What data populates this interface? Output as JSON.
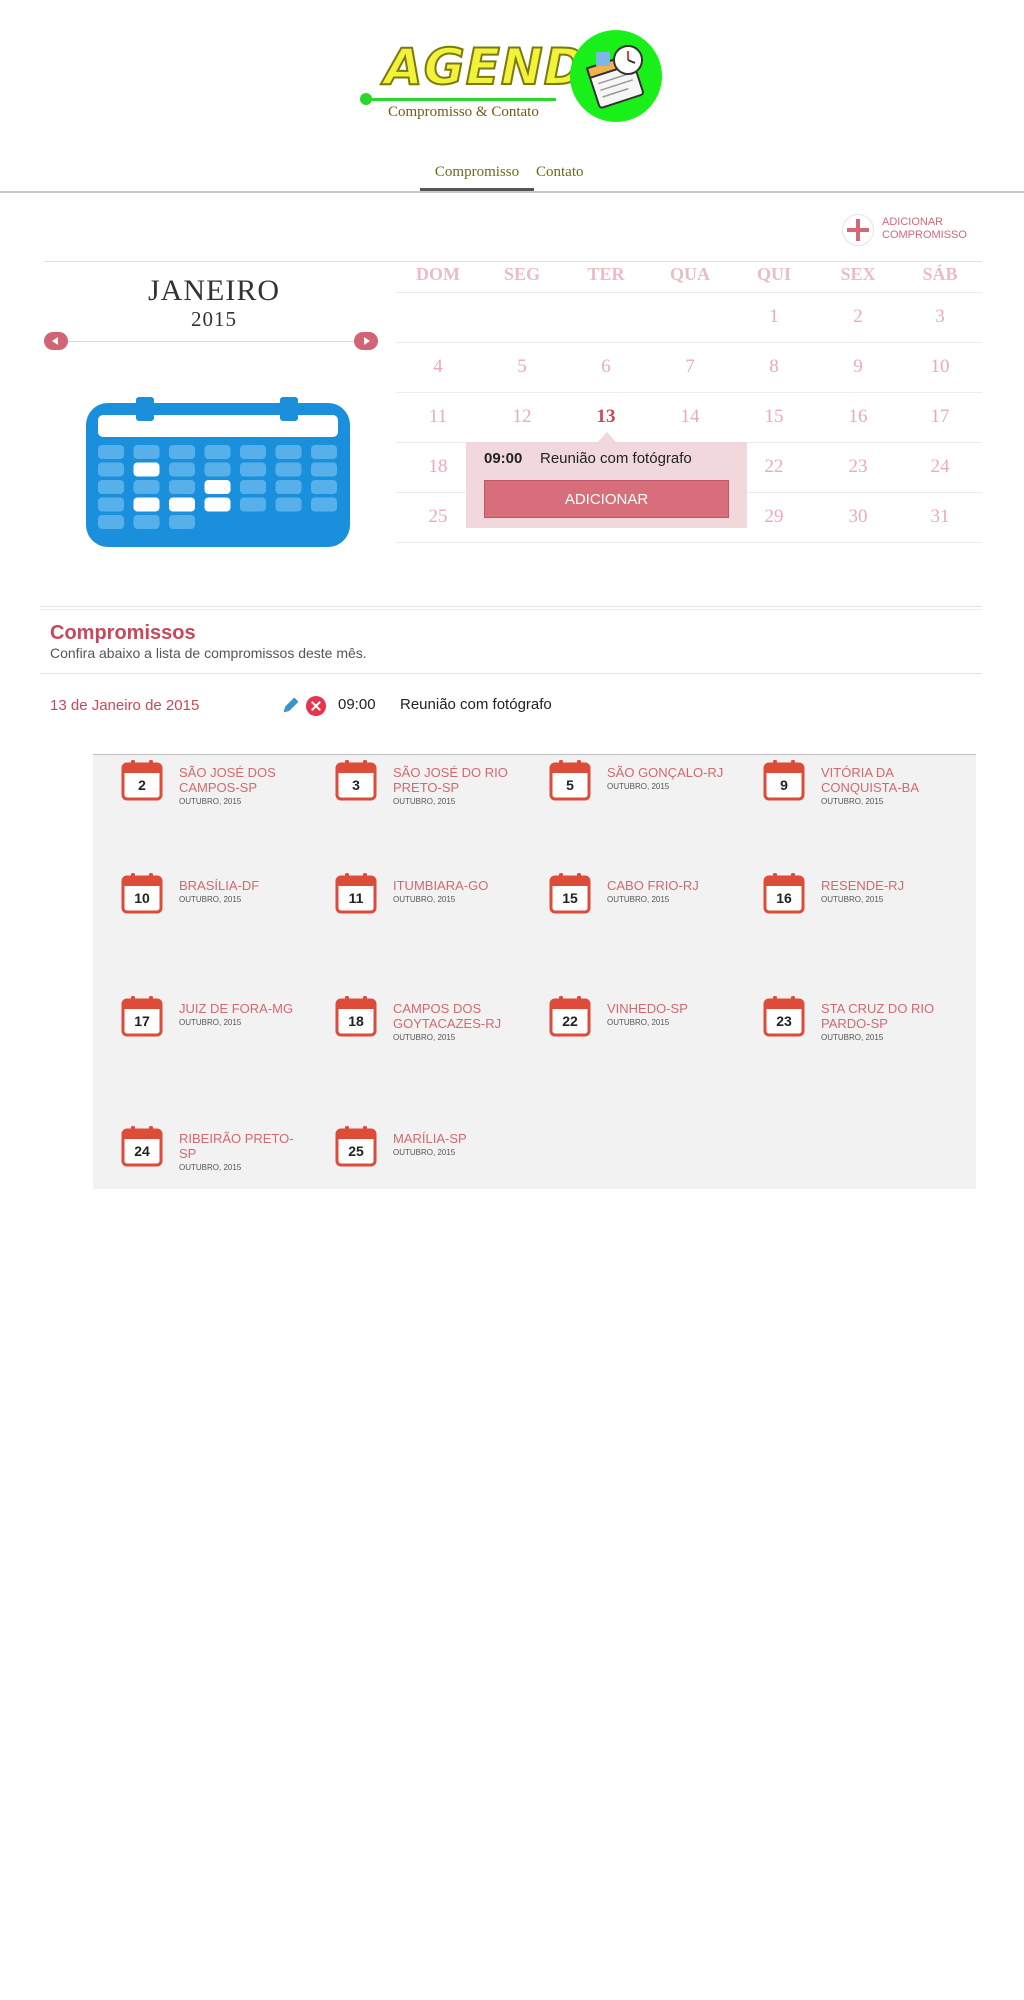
{
  "logo": {
    "word": "AGENDA",
    "subtitle": "Compromisso & Contato"
  },
  "nav": {
    "tabs": [
      {
        "label": "Compromisso"
      },
      {
        "label": "Contato"
      }
    ]
  },
  "actions": {
    "add_appointment_line1": "ADICIONAR",
    "add_appointment_line2": "COMPROMISSO"
  },
  "month": {
    "name": "JANEIRO",
    "year": "2015"
  },
  "calendar": {
    "weekdays": [
      "DOM",
      "SEG",
      "TER",
      "QUA",
      "QUI",
      "SEX",
      "SÁB"
    ],
    "today": 13,
    "days": [
      [
        "",
        "",
        "",
        "",
        "1",
        "2",
        "3"
      ],
      [
        "4",
        "5",
        "6",
        "7",
        "8",
        "9",
        "10"
      ],
      [
        "11",
        "12",
        "13",
        "14",
        "15",
        "16",
        "17"
      ],
      [
        "18",
        "",
        "",
        "",
        "22",
        "23",
        "24"
      ],
      [
        "25",
        "",
        "",
        "",
        "29",
        "30",
        "31"
      ]
    ]
  },
  "popup": {
    "time": "09:00",
    "title": "Reunião com fotógrafo",
    "button": "ADICIONAR"
  },
  "compromissos": {
    "title": "Compromissos",
    "subtitle": "Confira abaixo a lista de compromissos deste mês.",
    "items": [
      {
        "date": "13 de Janeiro de 2015",
        "time": "09:00",
        "title": "Reunião com fotógrafo"
      }
    ]
  },
  "events": [
    {
      "day": "2",
      "city": "SÃO JOSÉ DOS CAMPOS-SP",
      "month": "OUTUBRO, 2015"
    },
    {
      "day": "3",
      "city": "SÃO JOSÉ DO RIO PRETO-SP",
      "month": "OUTUBRO, 2015"
    },
    {
      "day": "5",
      "city": "SÃO GONÇALO-RJ",
      "month": "OUTUBRO, 2015"
    },
    {
      "day": "9",
      "city": "VITÓRIA DA CONQUISTA-BA",
      "month": "OUTUBRO, 2015"
    },
    {
      "day": "10",
      "city": "BRASÍLIA-DF",
      "month": "OUTUBRO, 2015"
    },
    {
      "day": "11",
      "city": "ITUMBIARA-GO",
      "month": "OUTUBRO, 2015"
    },
    {
      "day": "15",
      "city": "CABO FRIO-RJ",
      "month": "OUTUBRO, 2015"
    },
    {
      "day": "16",
      "city": "RESENDE-RJ",
      "month": "OUTUBRO, 2015"
    },
    {
      "day": "17",
      "city": "JUIZ DE FORA-MG",
      "month": "OUTUBRO, 2015"
    },
    {
      "day": "18",
      "city": "CAMPOS DOS GOYTACAZES-RJ",
      "month": "OUTUBRO, 2015"
    },
    {
      "day": "22",
      "city": "VINHEDO-SP",
      "month": "OUTUBRO, 2015"
    },
    {
      "day": "23",
      "city": "STA CRUZ DO RIO PARDO-SP",
      "month": "OUTUBRO, 2015"
    },
    {
      "day": "24",
      "city": "RIBEIRÃO PRETO-SP",
      "month": "OUTUBRO, 2015"
    },
    {
      "day": "25",
      "city": "MARÍLIA-SP",
      "month": "OUTUBRO, 2015"
    }
  ],
  "colors": {
    "accent": "#c9475a",
    "calendar_icon": "#1a8fdc",
    "logo_green": "#19f019",
    "logo_yellow": "#f2f23a"
  }
}
